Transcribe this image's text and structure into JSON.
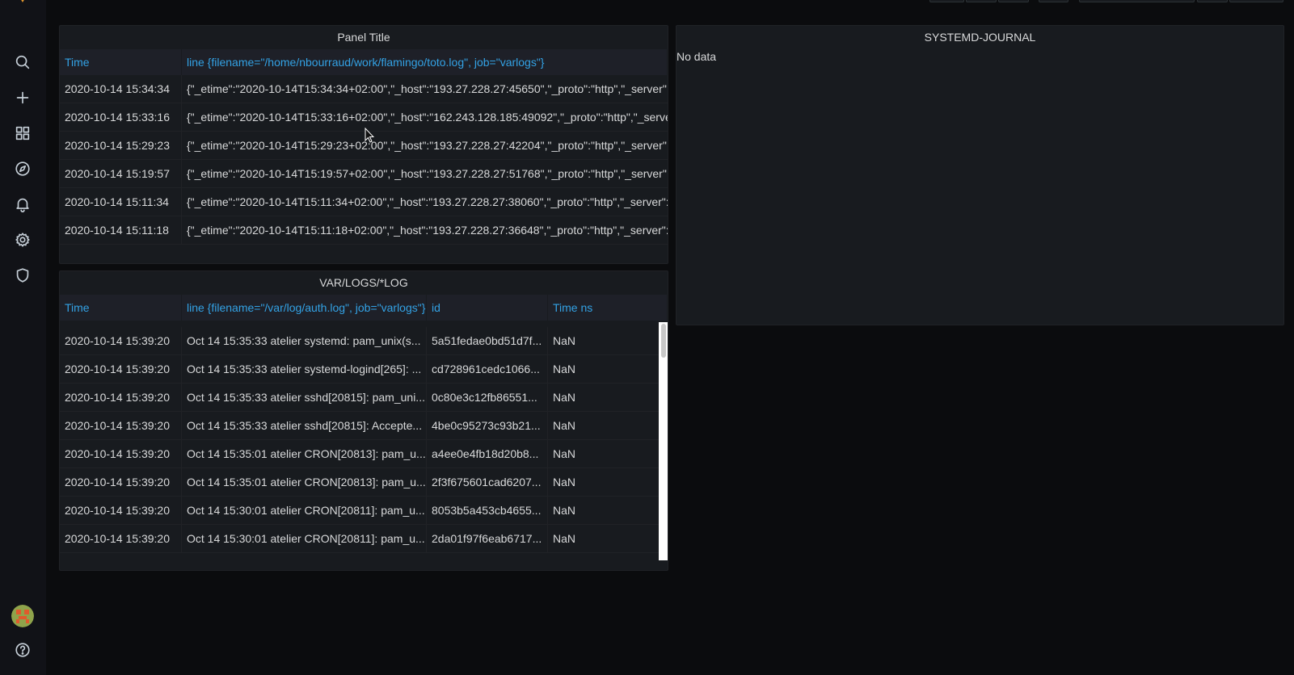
{
  "sidenav": {
    "items": [
      {
        "name": "search-icon",
        "label": "Search"
      },
      {
        "name": "plus-icon",
        "label": "Create"
      },
      {
        "name": "dashboards-icon",
        "label": "Dashboards"
      },
      {
        "name": "compass-icon",
        "label": "Explore"
      },
      {
        "name": "bell-icon",
        "label": "Alerting"
      },
      {
        "name": "gear-icon",
        "label": "Configuration"
      },
      {
        "name": "shield-icon",
        "label": "Server Admin"
      }
    ],
    "help_icon": "help-circle-icon",
    "avatar_icon": "user-avatar"
  },
  "panel_top": {
    "title": "Panel Title",
    "columns": [
      "Time",
      "line {filename=\"/home/nbourraud/work/flamingo/toto.log\", job=\"varlogs\"}"
    ],
    "rows": [
      [
        "2020-10-14 15:34:34",
        "{\"_etime\":\"2020-10-14T15:34:34+02:00\",\"_host\":\"193.27.228.27:45650\",\"_proto\":\"http\",\"_server\":\"[::]"
      ],
      [
        "2020-10-14 15:33:16",
        "{\"_etime\":\"2020-10-14T15:33:16+02:00\",\"_host\":\"162.243.128.185:49092\",\"_proto\":\"http\",\"_server\":\""
      ],
      [
        "2020-10-14 15:29:23",
        "{\"_etime\":\"2020-10-14T15:29:23+02:00\",\"_host\":\"193.27.228.27:42204\",\"_proto\":\"http\",\"_server\":\"[::]"
      ],
      [
        "2020-10-14 15:19:57",
        "{\"_etime\":\"2020-10-14T15:19:57+02:00\",\"_host\":\"193.27.228.27:51768\",\"_proto\":\"http\",\"_server\":\"[::]"
      ],
      [
        "2020-10-14 15:11:34",
        "{\"_etime\":\"2020-10-14T15:11:34+02:00\",\"_host\":\"193.27.228.27:38060\",\"_proto\":\"http\",\"_server\":\"[::]"
      ],
      [
        "2020-10-14 15:11:18",
        "{\"_etime\":\"2020-10-14T15:11:18+02:00\",\"_host\":\"193.27.228.27:36648\",\"_proto\":\"http\",\"_server\":\"[::]"
      ]
    ]
  },
  "panel_journal": {
    "title": "SYSTEMD-JOURNAL",
    "message": "No data"
  },
  "panel_varlogs": {
    "title": "VAR/LOGS/*LOG",
    "columns": [
      "Time",
      "line {filename=\"/var/log/auth.log\", job=\"varlogs\"}",
      "id",
      "Time ns"
    ],
    "rows": [
      [
        "2020-10-14 15:39:20",
        "Oct 14 15:35:33 atelier systemd: pam_unix(s...",
        "5a51fedae0bd51d7f...",
        "NaN"
      ],
      [
        "2020-10-14 15:39:20",
        "Oct 14 15:35:33 atelier systemd-logind[265]: ...",
        "cd728961cedc1066...",
        "NaN"
      ],
      [
        "2020-10-14 15:39:20",
        "Oct 14 15:35:33 atelier sshd[20815]: pam_uni...",
        "0c80e3c12fb86551...",
        "NaN"
      ],
      [
        "2020-10-14 15:39:20",
        "Oct 14 15:35:33 atelier sshd[20815]: Accepte...",
        "4be0c95273c93b21...",
        "NaN"
      ],
      [
        "2020-10-14 15:39:20",
        "Oct 14 15:35:01 atelier CRON[20813]: pam_u...",
        "a4ee0e4fb18d20b8...",
        "NaN"
      ],
      [
        "2020-10-14 15:39:20",
        "Oct 14 15:35:01 atelier CRON[20813]: pam_u...",
        "2f3f675601cad6207...",
        "NaN"
      ],
      [
        "2020-10-14 15:39:20",
        "Oct 14 15:30:01 atelier CRON[20811]: pam_u...",
        "8053b5a453cb4655...",
        "NaN"
      ],
      [
        "2020-10-14 15:39:20",
        "Oct 14 15:30:01 atelier CRON[20811]: pam_u...",
        "2da01f97f6eab6717...",
        "NaN"
      ]
    ]
  },
  "colors": {
    "link": "#33a2e5",
    "panel_bg": "#181b1f",
    "page_bg": "#0b0c0e",
    "text": "#d8d9da"
  }
}
